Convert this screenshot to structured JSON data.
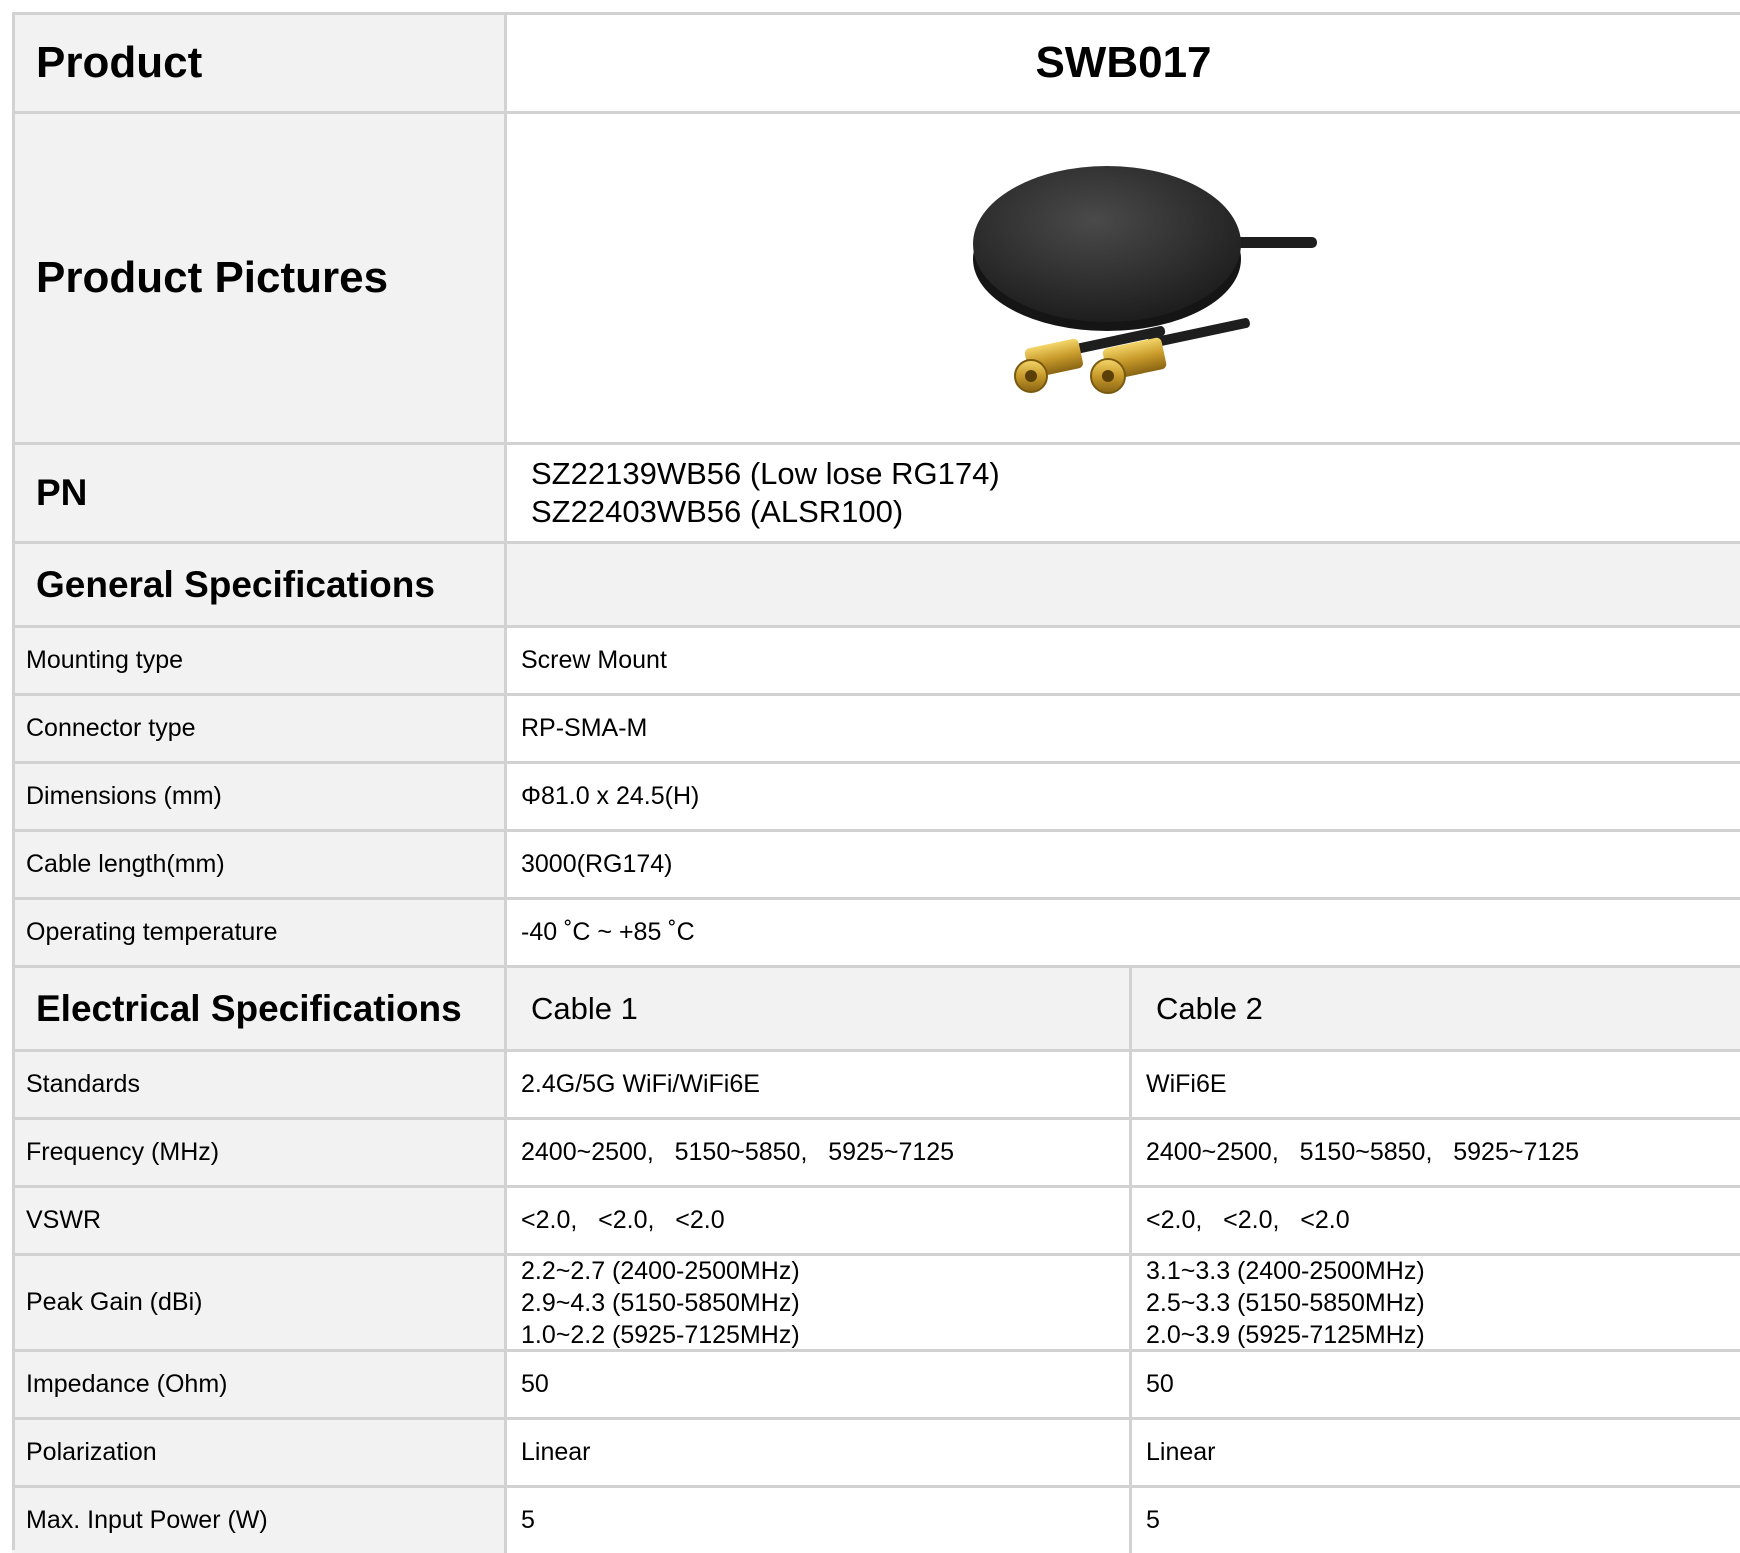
{
  "product": {
    "label": "Product",
    "value": "SWB017"
  },
  "pictures": {
    "label": "Product Pictures"
  },
  "pn": {
    "label": "PN",
    "lines": [
      "SZ22139WB56 (Low lose RG174)",
      "SZ22403WB56 (ALSR100)"
    ]
  },
  "general": {
    "heading": "General Specifications",
    "rows": [
      {
        "label": "Mounting type",
        "value": "Screw Mount"
      },
      {
        "label": "Connector type",
        "value": "RP-SMA-M"
      },
      {
        "label": "Dimensions (mm)",
        "value": "Φ81.0 x 24.5(H)"
      },
      {
        "label": "Cable length(mm)",
        "value": "3000(RG174)"
      },
      {
        "label": "Operating temperature",
        "value": "-40 ˚C ~ +85 ˚C"
      }
    ]
  },
  "electrical": {
    "heading": "Electrical Specifications",
    "cable1": "Cable 1",
    "cable2": "Cable 2",
    "rows": [
      {
        "label": "Standards",
        "c1": [
          "2.4G/5G WiFi/WiFi6E"
        ],
        "c2": [
          "WiFi6E"
        ]
      },
      {
        "label": "Frequency (MHz)",
        "c1": [
          "2400~2500,   5150~5850,   5925~7125"
        ],
        "c2": [
          "2400~2500,   5150~5850,   5925~7125"
        ]
      },
      {
        "label": "VSWR",
        "c1": [
          "<2.0,   <2.0,   <2.0"
        ],
        "c2": [
          "<2.0,   <2.0,   <2.0"
        ]
      },
      {
        "label": "Peak Gain (dBi)",
        "c1": [
          "2.2~2.7 (2400-2500MHz)",
          "2.9~4.3 (5150-5850MHz)",
          "1.0~2.2 (5925-7125MHz)"
        ],
        "c2": [
          "3.1~3.3 (2400-2500MHz)",
          "2.5~3.3 (5150-5850MHz)",
          "2.0~3.9 (5925-7125MHz)"
        ]
      },
      {
        "label": "Impedance (Ohm)",
        "c1": [
          "50"
        ],
        "c2": [
          "50"
        ]
      },
      {
        "label": "Polarization",
        "c1": [
          "Linear"
        ],
        "c2": [
          "Linear"
        ]
      },
      {
        "label": "Max. Input Power (W)",
        "c1": [
          "5"
        ],
        "c2": [
          "5"
        ]
      }
    ]
  }
}
